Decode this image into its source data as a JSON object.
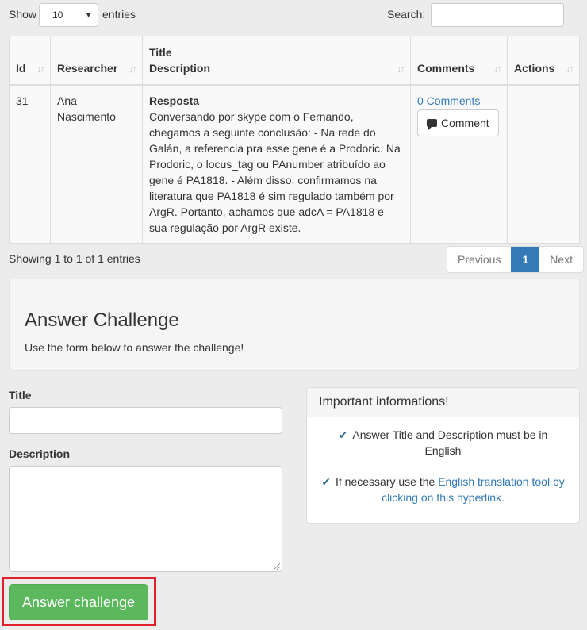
{
  "length_menu": {
    "show_label": "Show",
    "value": "10",
    "entries_label": "entries"
  },
  "search": {
    "label": "Search:",
    "value": ""
  },
  "table": {
    "headers": [
      "Id",
      "Researcher",
      "Title",
      "Description",
      "Comments",
      "Actions"
    ],
    "rows": [
      {
        "id": "31",
        "researcher": "Ana Nascimento",
        "title": "Resposta",
        "description": "Conversando por skype com o Fernando, chegamos a seguinte conclusão: - Na rede do Galán, a referencia pra esse gene é a Prodoric. Na Prodoric, o locus_tag ou PAnumber atribuído ao gene é PA1818. - Além disso, confirmamos na literatura que PA1818 é sim regulado também por ArgR. Portanto, achamos que adcA = PA1818 e sua regulação por ArgR existe.",
        "comments_link": "0 Comments",
        "comment_button": "Comment"
      }
    ]
  },
  "info": "Showing 1 to 1 of 1 entries",
  "pagination": {
    "previous": "Previous",
    "current": "1",
    "next": "Next"
  },
  "challenge": {
    "title": "Answer Challenge",
    "subtitle": "Use the form below to answer the challenge!"
  },
  "form": {
    "title_label": "Title",
    "title_value": "",
    "description_label": "Description",
    "description_value": "",
    "submit_label": "Answer challenge"
  },
  "panel": {
    "heading": "Important informations!",
    "item1": "Answer Title and Description must be in English",
    "item2_prefix": "If necessary use the ",
    "item2_link": "English translation tool by clicking on this hyperlink."
  },
  "colors": {
    "primary": "#337ab7",
    "success": "#5cb85c",
    "highlight": "#e0202a"
  }
}
